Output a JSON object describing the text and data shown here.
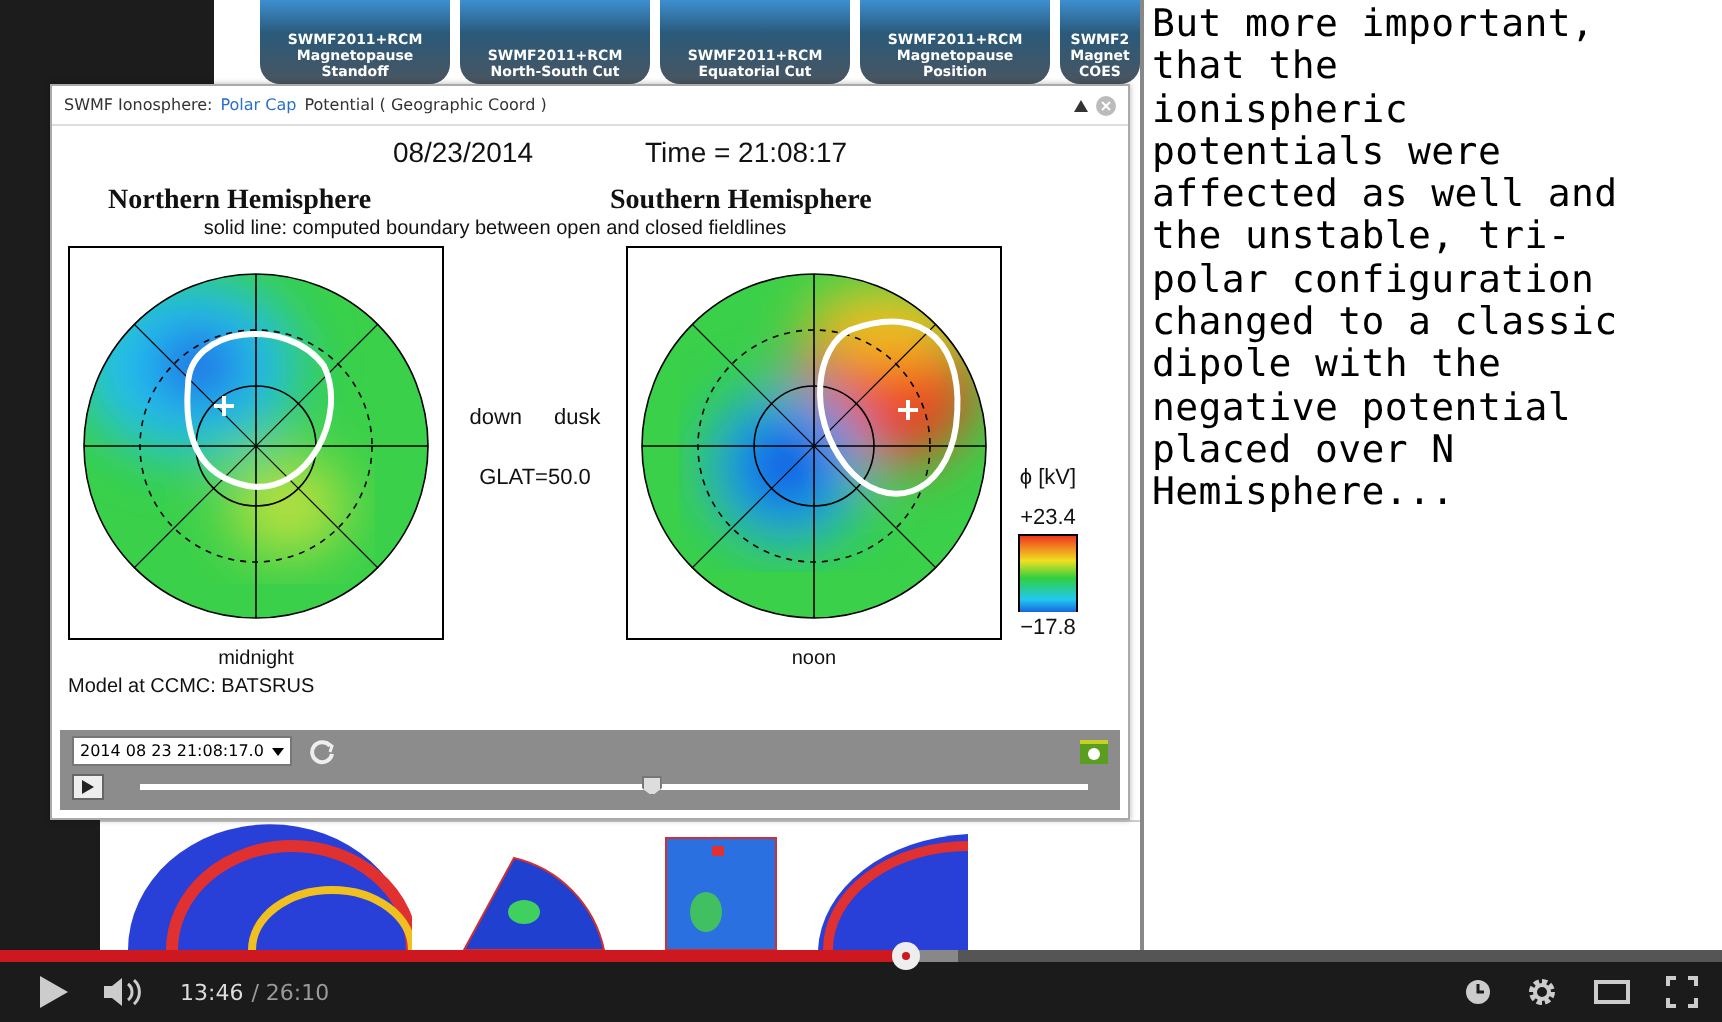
{
  "top_thumbnails": [
    {
      "lines": [
        "SWMF2011+RCM",
        "Magnetopause",
        "Standoff"
      ]
    },
    {
      "lines": [
        "SWMF2011+RCM",
        "North-South Cut"
      ]
    },
    {
      "lines": [
        "SWMF2011+RCM",
        "Equatorial Cut"
      ]
    },
    {
      "lines": [
        "SWMF2011+RCM",
        "Magnetopause",
        "Position"
      ]
    },
    {
      "lines": [
        "SWMF2",
        "Magnet",
        "COES"
      ]
    }
  ],
  "window": {
    "title_prefix": "SWMF Ionosphere:",
    "title_link": "Polar Cap",
    "title_suffix": "Potential ( Geographic Coord )"
  },
  "plot": {
    "date": "08/23/2014",
    "time": "Time = 21:08:17",
    "north_title": "Northern Hemisphere",
    "south_title": "Southern Hemisphere",
    "subtitle": "solid line: computed boundary between open and closed fieldlines",
    "down_label": "down",
    "dusk_label": "dusk",
    "glat": "GLAT=50.0",
    "north_bottom": "midnight",
    "south_bottom": "noon",
    "model": "Model at CCMC: BATSRUS",
    "colorbar_label": "ϕ [kV]",
    "colorbar_max": "+23.4",
    "colorbar_min": "−17.8"
  },
  "player": {
    "time_select": "2014 08 23 21:08:17.0",
    "level": 0.54
  },
  "narration": "But more important,\nthat the\nionispheric\npotentials were\naffected as well and\nthe unstable, tri-\npolar configuration\nchanged to a classic\ndipole with the\nnegative potential\nplaced over N\nHemisphere...",
  "video_controls": {
    "level": 0.526,
    "current_time": "13:46",
    "duration": "/ 26:10"
  }
}
